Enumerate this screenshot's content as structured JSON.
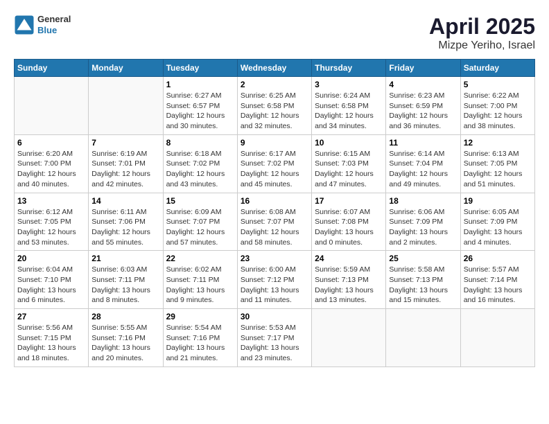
{
  "header": {
    "logo_general": "General",
    "logo_blue": "Blue",
    "title": "April 2025",
    "subtitle": "Mizpe Yeriho, Israel"
  },
  "days_of_week": [
    "Sunday",
    "Monday",
    "Tuesday",
    "Wednesday",
    "Thursday",
    "Friday",
    "Saturday"
  ],
  "weeks": [
    [
      {
        "day": "",
        "info": ""
      },
      {
        "day": "",
        "info": ""
      },
      {
        "day": "1",
        "info": "Sunrise: 6:27 AM\nSunset: 6:57 PM\nDaylight: 12 hours\nand 30 minutes."
      },
      {
        "day": "2",
        "info": "Sunrise: 6:25 AM\nSunset: 6:58 PM\nDaylight: 12 hours\nand 32 minutes."
      },
      {
        "day": "3",
        "info": "Sunrise: 6:24 AM\nSunset: 6:58 PM\nDaylight: 12 hours\nand 34 minutes."
      },
      {
        "day": "4",
        "info": "Sunrise: 6:23 AM\nSunset: 6:59 PM\nDaylight: 12 hours\nand 36 minutes."
      },
      {
        "day": "5",
        "info": "Sunrise: 6:22 AM\nSunset: 7:00 PM\nDaylight: 12 hours\nand 38 minutes."
      }
    ],
    [
      {
        "day": "6",
        "info": "Sunrise: 6:20 AM\nSunset: 7:00 PM\nDaylight: 12 hours\nand 40 minutes."
      },
      {
        "day": "7",
        "info": "Sunrise: 6:19 AM\nSunset: 7:01 PM\nDaylight: 12 hours\nand 42 minutes."
      },
      {
        "day": "8",
        "info": "Sunrise: 6:18 AM\nSunset: 7:02 PM\nDaylight: 12 hours\nand 43 minutes."
      },
      {
        "day": "9",
        "info": "Sunrise: 6:17 AM\nSunset: 7:02 PM\nDaylight: 12 hours\nand 45 minutes."
      },
      {
        "day": "10",
        "info": "Sunrise: 6:15 AM\nSunset: 7:03 PM\nDaylight: 12 hours\nand 47 minutes."
      },
      {
        "day": "11",
        "info": "Sunrise: 6:14 AM\nSunset: 7:04 PM\nDaylight: 12 hours\nand 49 minutes."
      },
      {
        "day": "12",
        "info": "Sunrise: 6:13 AM\nSunset: 7:05 PM\nDaylight: 12 hours\nand 51 minutes."
      }
    ],
    [
      {
        "day": "13",
        "info": "Sunrise: 6:12 AM\nSunset: 7:05 PM\nDaylight: 12 hours\nand 53 minutes."
      },
      {
        "day": "14",
        "info": "Sunrise: 6:11 AM\nSunset: 7:06 PM\nDaylight: 12 hours\nand 55 minutes."
      },
      {
        "day": "15",
        "info": "Sunrise: 6:09 AM\nSunset: 7:07 PM\nDaylight: 12 hours\nand 57 minutes."
      },
      {
        "day": "16",
        "info": "Sunrise: 6:08 AM\nSunset: 7:07 PM\nDaylight: 12 hours\nand 58 minutes."
      },
      {
        "day": "17",
        "info": "Sunrise: 6:07 AM\nSunset: 7:08 PM\nDaylight: 13 hours\nand 0 minutes."
      },
      {
        "day": "18",
        "info": "Sunrise: 6:06 AM\nSunset: 7:09 PM\nDaylight: 13 hours\nand 2 minutes."
      },
      {
        "day": "19",
        "info": "Sunrise: 6:05 AM\nSunset: 7:09 PM\nDaylight: 13 hours\nand 4 minutes."
      }
    ],
    [
      {
        "day": "20",
        "info": "Sunrise: 6:04 AM\nSunset: 7:10 PM\nDaylight: 13 hours\nand 6 minutes."
      },
      {
        "day": "21",
        "info": "Sunrise: 6:03 AM\nSunset: 7:11 PM\nDaylight: 13 hours\nand 8 minutes."
      },
      {
        "day": "22",
        "info": "Sunrise: 6:02 AM\nSunset: 7:11 PM\nDaylight: 13 hours\nand 9 minutes."
      },
      {
        "day": "23",
        "info": "Sunrise: 6:00 AM\nSunset: 7:12 PM\nDaylight: 13 hours\nand 11 minutes."
      },
      {
        "day": "24",
        "info": "Sunrise: 5:59 AM\nSunset: 7:13 PM\nDaylight: 13 hours\nand 13 minutes."
      },
      {
        "day": "25",
        "info": "Sunrise: 5:58 AM\nSunset: 7:13 PM\nDaylight: 13 hours\nand 15 minutes."
      },
      {
        "day": "26",
        "info": "Sunrise: 5:57 AM\nSunset: 7:14 PM\nDaylight: 13 hours\nand 16 minutes."
      }
    ],
    [
      {
        "day": "27",
        "info": "Sunrise: 5:56 AM\nSunset: 7:15 PM\nDaylight: 13 hours\nand 18 minutes."
      },
      {
        "day": "28",
        "info": "Sunrise: 5:55 AM\nSunset: 7:16 PM\nDaylight: 13 hours\nand 20 minutes."
      },
      {
        "day": "29",
        "info": "Sunrise: 5:54 AM\nSunset: 7:16 PM\nDaylight: 13 hours\nand 21 minutes."
      },
      {
        "day": "30",
        "info": "Sunrise: 5:53 AM\nSunset: 7:17 PM\nDaylight: 13 hours\nand 23 minutes."
      },
      {
        "day": "",
        "info": ""
      },
      {
        "day": "",
        "info": ""
      },
      {
        "day": "",
        "info": ""
      }
    ]
  ]
}
